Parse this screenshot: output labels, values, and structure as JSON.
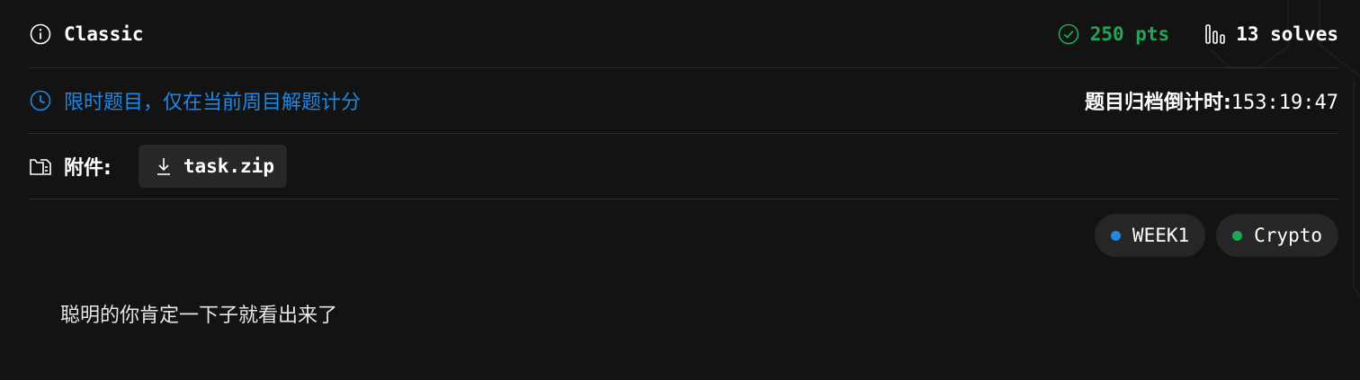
{
  "challenge": {
    "title": "Classic",
    "points": "250 pts",
    "solves": "13 solves",
    "timed_notice": "限时题目，仅在当前周目解题计分",
    "countdown_label": "题目归档倒计时:",
    "countdown_value": "153:19:47",
    "attachment_label": "附件:",
    "attachment_file": "task.zip",
    "tags": [
      {
        "label": "WEEK1",
        "color": "#1e88e5"
      },
      {
        "label": "Crypto",
        "color": "#22a559"
      }
    ],
    "description": "聪明的你肯定一下子就看出来了"
  },
  "colors": {
    "background": "#131313",
    "accent_blue": "#1e88e5",
    "accent_green": "#22a559",
    "chip_bg": "#262626"
  },
  "icons": {
    "title": "info-icon",
    "points": "check-circle-icon",
    "solves": "bar-chart-icon",
    "timed": "clock-icon",
    "attachment": "folder-file-icon",
    "download": "download-icon"
  }
}
